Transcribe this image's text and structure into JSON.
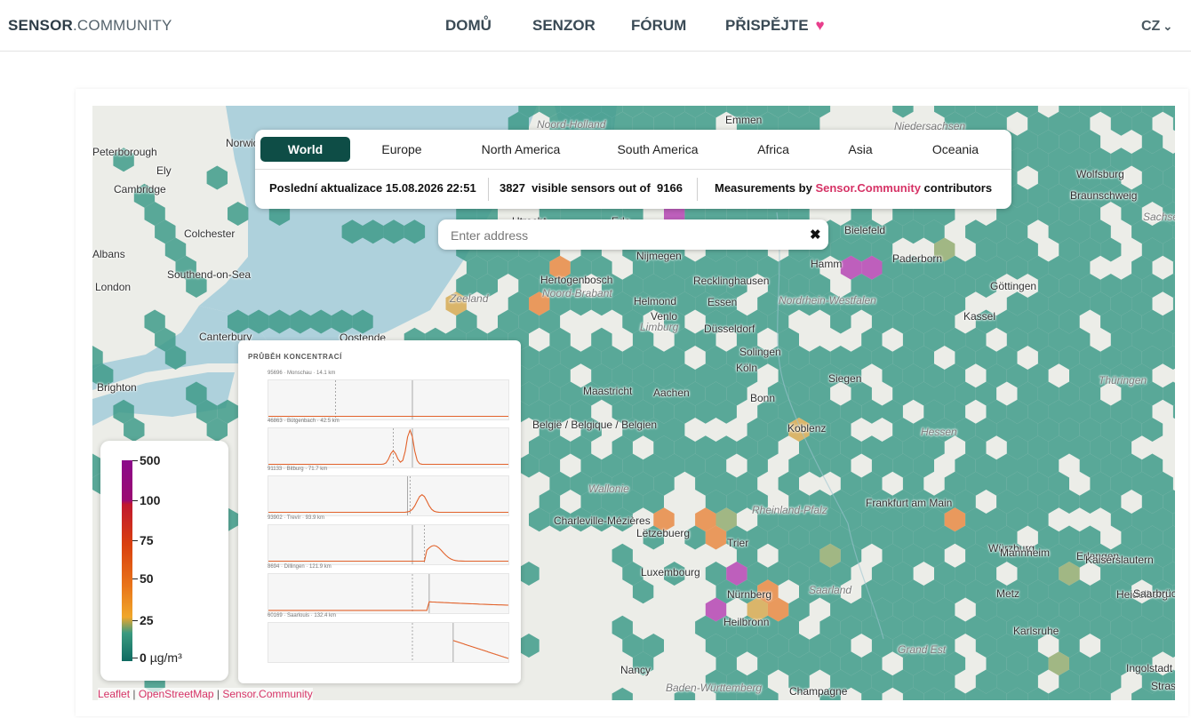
{
  "header": {
    "brand_bold": "SENSOR",
    "brand_light": ".COMMUNITY",
    "nav": [
      {
        "label": "DOMŮ"
      },
      {
        "label": "SENZOR"
      },
      {
        "label": "FÓRUM"
      },
      {
        "label": "PŘISPĚJTE"
      }
    ],
    "heart_icon": "heart-icon",
    "language": "CZ"
  },
  "region_tabs": [
    "World",
    "Europe",
    "North America",
    "South America",
    "Africa",
    "Asia",
    "Oceania"
  ],
  "active_tab": "World",
  "status": {
    "last_update": "Poslední aktualizace 15.08.2026 22:51",
    "visible_count": "3827",
    "visible_text": "visible sensors out of",
    "total_count": "9166",
    "measurements_prefix": "Measurements by",
    "measurements_link": "Sensor.Community",
    "measurements_suffix": "contributors"
  },
  "search": {
    "placeholder": "Enter address",
    "clear_icon": "close-icon"
  },
  "legend": {
    "ticks": [
      "500",
      "100",
      "75",
      "50",
      "25",
      "0"
    ],
    "unit": "µg/m³",
    "colors": [
      "#8b0a8a",
      "#c0182f",
      "#d94812",
      "#ee8b1a",
      "#f2a52b",
      "#1f8f7a",
      "#0f6b62"
    ]
  },
  "chart_popup": {
    "title": "PRŮBĚH KONCENTRACÍ",
    "series": [
      {
        "label": "95696 · Monschau · 14.1 km",
        "shape": "flat"
      },
      {
        "label": "46863 · Bütgenbach · 42.5 km",
        "shape": "spike"
      },
      {
        "label": "91133 · Bitburg · 71.7 km",
        "shape": "bump"
      },
      {
        "label": "93902 · Trevír · 93.9 km",
        "shape": "wave"
      },
      {
        "label": "8694 · Dillingen · 121.9 km",
        "shape": "plateau"
      },
      {
        "label": "60169 · Saarlouis · 132.4 km",
        "shape": "tail"
      }
    ]
  },
  "map_labels": [
    {
      "text": "Norwich",
      "kind": "city"
    },
    {
      "text": "Peterborough",
      "kind": "city"
    },
    {
      "text": "Ely",
      "kind": "city"
    },
    {
      "text": "Cambridge",
      "kind": "city"
    },
    {
      "text": "Colchester",
      "kind": "city"
    },
    {
      "text": "Albans",
      "kind": "city"
    },
    {
      "text": "Southend-on-Sea",
      "kind": "city"
    },
    {
      "text": "London",
      "kind": "city"
    },
    {
      "text": "Canterbury",
      "kind": "city"
    },
    {
      "text": "Brighton",
      "kind": "city"
    },
    {
      "text": "Oostende",
      "kind": "city"
    },
    {
      "text": "Noord-Holland",
      "kind": "region"
    },
    {
      "text": "Emmen",
      "kind": "city"
    },
    {
      "text": "Niedersachsen",
      "kind": "region"
    },
    {
      "text": "Wolfsburg",
      "kind": "city"
    },
    {
      "text": "Braunschweig",
      "kind": "city"
    },
    {
      "text": "Sachsen-Anhalt",
      "kind": "region"
    },
    {
      "text": "Utrecht",
      "kind": "city"
    },
    {
      "text": "Ede",
      "kind": "city"
    },
    {
      "text": "Bielefeld",
      "kind": "city"
    },
    {
      "text": "Nijmegen",
      "kind": "city"
    },
    {
      "text": "Hamm",
      "kind": "city"
    },
    {
      "text": "Paderborn",
      "kind": "city"
    },
    {
      "text": "Hertogenbosch",
      "kind": "city"
    },
    {
      "text": "Noord-Brabant",
      "kind": "region"
    },
    {
      "text": "Zeeland",
      "kind": "region"
    },
    {
      "text": "Recklinghausen",
      "kind": "city"
    },
    {
      "text": "Helmond",
      "kind": "city"
    },
    {
      "text": "Essen",
      "kind": "city"
    },
    {
      "text": "Nordrhein-Westfalen",
      "kind": "region"
    },
    {
      "text": "Göttingen",
      "kind": "city"
    },
    {
      "text": "Venlo",
      "kind": "city"
    },
    {
      "text": "Düsseldorf",
      "kind": "city"
    },
    {
      "text": "Kassel",
      "kind": "city"
    },
    {
      "text": "Limburg",
      "kind": "region"
    },
    {
      "text": "Solingen",
      "kind": "city"
    },
    {
      "text": "Köln",
      "kind": "city"
    },
    {
      "text": "Siegen",
      "kind": "city"
    },
    {
      "text": "Maastricht",
      "kind": "city"
    },
    {
      "text": "Aachen",
      "kind": "city"
    },
    {
      "text": "Bonn",
      "kind": "city"
    },
    {
      "text": "Thüringen",
      "kind": "region"
    },
    {
      "text": "België / Belgique / Belgien",
      "kind": "city"
    },
    {
      "text": "Hessen",
      "kind": "region"
    },
    {
      "text": "Koblenz",
      "kind": "city"
    },
    {
      "text": "Wallonie",
      "kind": "region"
    },
    {
      "text": "Rheinland-Pfalz",
      "kind": "region"
    },
    {
      "text": "Frankfurt am Main",
      "kind": "city"
    },
    {
      "text": "Charleville-Mézières",
      "kind": "city"
    },
    {
      "text": "Lëtzebuerg",
      "kind": "city"
    },
    {
      "text": "Trier",
      "kind": "city"
    },
    {
      "text": "Würzburg",
      "kind": "city"
    },
    {
      "text": "Erlangen",
      "kind": "city"
    },
    {
      "text": "Luxembourg",
      "kind": "city"
    },
    {
      "text": "Mannheim",
      "kind": "city"
    },
    {
      "text": "Kaiserslautern",
      "kind": "city"
    },
    {
      "text": "Saarland",
      "kind": "region"
    },
    {
      "text": "Heidelberg",
      "kind": "city"
    },
    {
      "text": "Nürnberg",
      "kind": "city"
    },
    {
      "text": "Saarbrücken",
      "kind": "city"
    },
    {
      "text": "Metz",
      "kind": "city"
    },
    {
      "text": "Heilbronn",
      "kind": "city"
    },
    {
      "text": "Karlsruhe",
      "kind": "city"
    },
    {
      "text": "Grand Est",
      "kind": "region"
    },
    {
      "text": "Ingolstadt",
      "kind": "city"
    },
    {
      "text": "Nancy",
      "kind": "city"
    },
    {
      "text": "Strasbourg",
      "kind": "city"
    },
    {
      "text": "Baden-Württemberg",
      "kind": "region"
    },
    {
      "text": "Champagne",
      "kind": "city"
    }
  ],
  "attribution": {
    "leaflet": "Leaflet",
    "osm": "OpenStreetMap",
    "sc": "Sensor.Community"
  },
  "hex_colors": {
    "good": "#3f9b8a",
    "moderate": "#d6a64a",
    "orange": "#e8833a",
    "purple": "#b33bb0",
    "olive": "#8fa96a"
  }
}
